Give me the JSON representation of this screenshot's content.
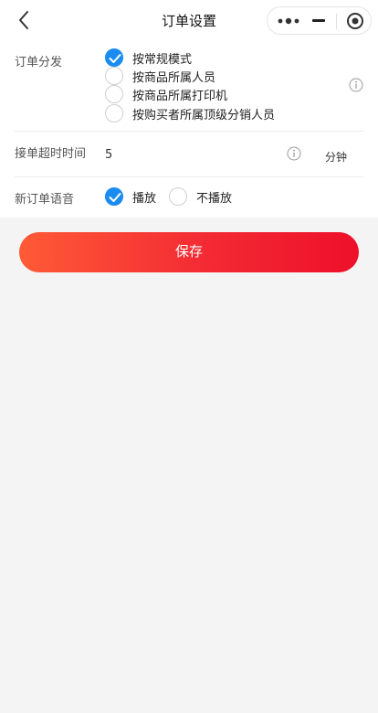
{
  "nav": {
    "title": "订单设置"
  },
  "dispatch": {
    "label": "订单分发",
    "options": [
      {
        "label": "按常规模式",
        "checked": true
      },
      {
        "label": "按商品所属人员",
        "checked": false
      },
      {
        "label": "按商品所属打印机",
        "checked": false
      },
      {
        "label": "按购买者所属顶级分销人员",
        "checked": false
      }
    ]
  },
  "timeout": {
    "label": "接单超时时间",
    "value": "5",
    "unit": "分钟"
  },
  "voice": {
    "label": "新订单语音",
    "options": [
      {
        "label": "播放",
        "checked": true
      },
      {
        "label": "不播放",
        "checked": false
      }
    ]
  },
  "save_label": "保存",
  "colors": {
    "accent": "#1a8cf1",
    "button_start": "#ff5a36",
    "button_end": "#ee1029"
  }
}
